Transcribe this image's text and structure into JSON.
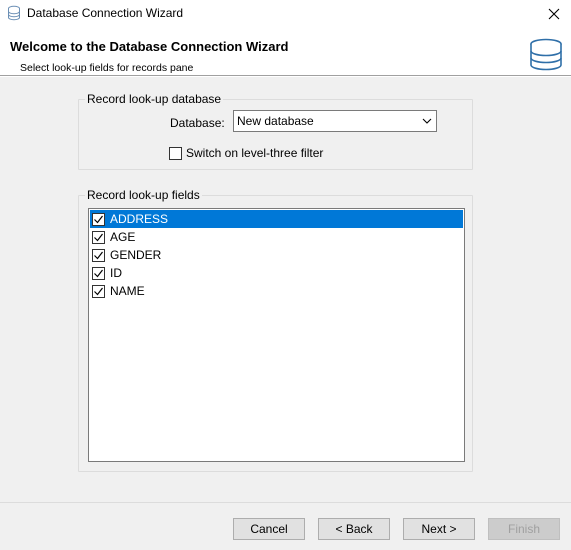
{
  "window": {
    "title": "Database Connection Wizard",
    "close_glyph": "✕"
  },
  "header": {
    "heading": "Welcome to the Database Connection Wizard",
    "subheading": "Select look-up fields for records pane",
    "icon": "database-icon"
  },
  "lookup_database": {
    "legend": "Record look-up database",
    "database_label": "Database:",
    "database_value": "New database",
    "level_three_filter_label": "Switch on level-three filter",
    "level_three_filter_checked": false
  },
  "lookup_fields": {
    "legend": "Record look-up fields",
    "items": [
      {
        "label": "ADDRESS",
        "checked": true,
        "selected": true
      },
      {
        "label": "AGE",
        "checked": true,
        "selected": false
      },
      {
        "label": "GENDER",
        "checked": true,
        "selected": false
      },
      {
        "label": "ID",
        "checked": true,
        "selected": false
      },
      {
        "label": "NAME",
        "checked": true,
        "selected": false
      }
    ]
  },
  "buttons": {
    "cancel": "Cancel",
    "back": "< Back",
    "next": "Next >",
    "finish": "Finish",
    "finish_enabled": false
  },
  "colors": {
    "selection": "#0078d7",
    "dialog_bg": "#f0f0f0"
  }
}
